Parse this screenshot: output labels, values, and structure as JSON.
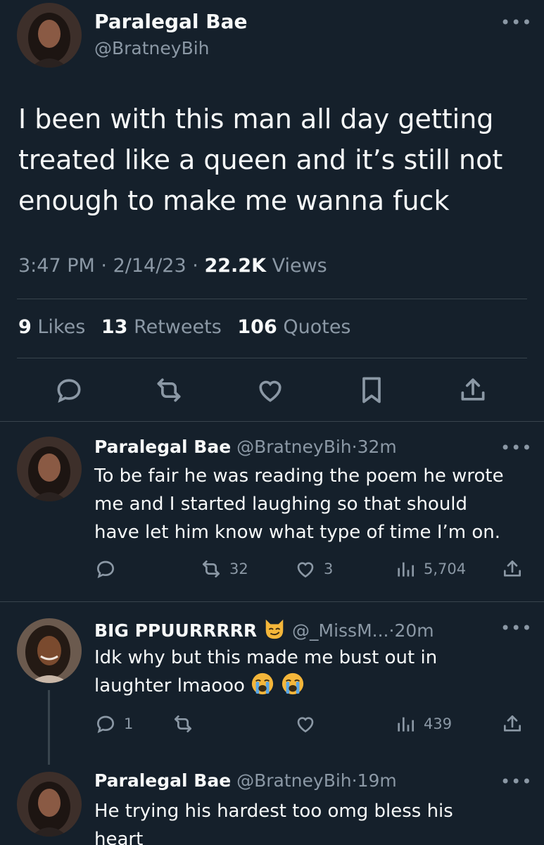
{
  "main_tweet": {
    "display_name": "Paralegal Bae",
    "handle": "@BratneyBih",
    "text_lines": [
      "I been with this man all day getting",
      "treated like a queen and it’s still not",
      "enough to make me wanna fuck"
    ],
    "time": "3:47 PM",
    "date": "2/14/23",
    "views_count": "22.2K",
    "views_label": "Views",
    "likes_count": "9",
    "likes_label": "Likes",
    "retweets_count": "13",
    "retweets_label": "Retweets",
    "quotes_count": "106",
    "quotes_label": "Quotes",
    "more_glyph": "•••",
    "sep": "·"
  },
  "replies": [
    {
      "display_name": "Paralegal Bae",
      "handle": "@BratneyBih",
      "time": "32m",
      "text_lines": [
        "To be fair he was reading the poem he wrote",
        "me and I started laughing so that should",
        "have let him know what type of time I’m on."
      ],
      "reply_count": "",
      "retweet_count": "32",
      "like_count": "3",
      "view_count": "5,704"
    },
    {
      "display_name": "BIG PPUURRRRR",
      "name_emoji": "smirking-cat-emoji",
      "handle": "@_MissM...",
      "time": "20m",
      "text_lines": [
        "Idk why but this made me bust out in",
        "laughter lmaooo"
      ],
      "text_emojis": [
        "loudly-crying-face-emoji",
        "loudly-crying-face-emoji"
      ],
      "reply_count": "1",
      "retweet_count": "",
      "like_count": "",
      "view_count": "439"
    },
    {
      "display_name": "Paralegal Bae",
      "handle": "@BratneyBih",
      "time": "19m",
      "text_lines": [
        "He trying his hardest too omg bless his",
        "heart"
      ]
    }
  ],
  "colors": {
    "background": "#15202b",
    "text": "#f7f9f9",
    "muted": "#8b98a5",
    "divider": "#38444d"
  }
}
